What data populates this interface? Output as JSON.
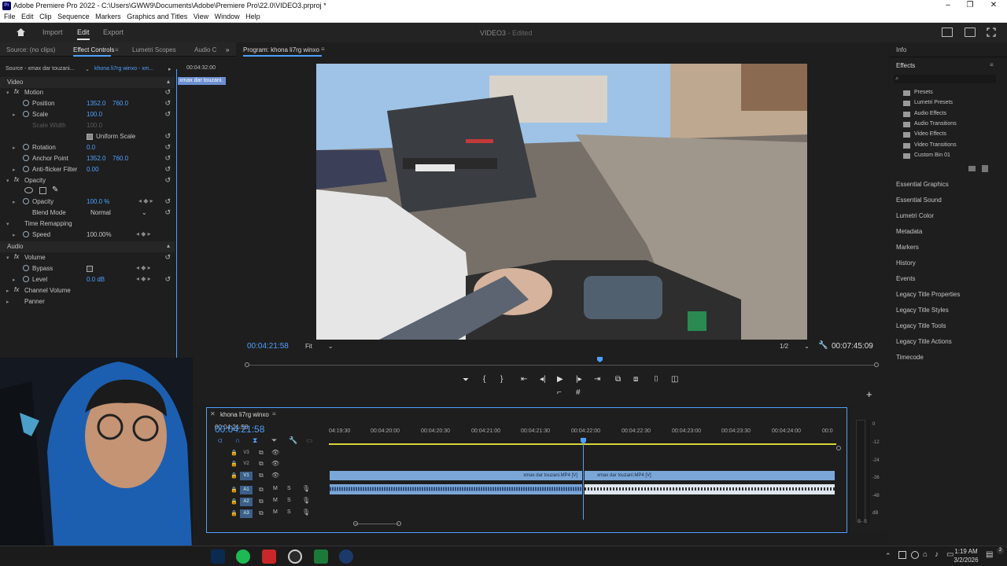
{
  "titlebar": {
    "logo": "Pr",
    "title": "Adobe Premiere Pro 2022 - C:\\Users\\GWW9\\Documents\\Adobe\\Premiere Pro\\22.0\\VIDEO3.prproj *",
    "min": "–",
    "max": "❐",
    "close": "✕"
  },
  "menu": [
    "File",
    "Edit",
    "Clip",
    "Sequence",
    "Markers",
    "Graphics and Titles",
    "View",
    "Window",
    "Help"
  ],
  "header": {
    "home_icon": "home-icon",
    "import": "Import",
    "edit": "Edit",
    "export": "Export",
    "project": "VIDEO3",
    "status": "- Edited"
  },
  "left_panel": {
    "tabs": [
      "Source: (no clips)",
      "Effect Controls",
      "Lumetri Scopes",
      "Audio C"
    ],
    "source": "Source - xmax dar touzani...",
    "sequence": "khona li7rg winxo - xm...",
    "timecode": "00:04:32:00",
    "clip_label": "xmax dar touzani.",
    "video_header": "Video",
    "motion": "Motion",
    "position_label": "Position",
    "position_x": "1352.0",
    "position_y": "760.0",
    "scale_label": "Scale",
    "scale": "100.0",
    "scale_width_label": "Scale Width",
    "scale_width": "100.0",
    "uniform_scale": "Uniform Scale",
    "rotation_label": "Rotation",
    "rotation": "0.0",
    "anchor_label": "Anchor Point",
    "anchor_x": "1352.0",
    "anchor_y": "760.0",
    "antiflicker_label": "Anti-flicker Filter",
    "antiflicker": "0.00",
    "opacity_header": "Opacity",
    "opacity_label": "Opacity",
    "opacity": "100.0 %",
    "blend_label": "Blend Mode",
    "blend": "Normal",
    "time_remap": "Time Remapping",
    "speed_label": "Speed",
    "speed": "100.00%",
    "audio_header": "Audio",
    "volume": "Volume",
    "bypass_label": "Bypass",
    "level_label": "Level",
    "level": "0.0 dB",
    "channel_volume": "Channel Volume",
    "panner": "Panner",
    "bottom_timecode": "00:04:..."
  },
  "program": {
    "tab": "Program: khona li7rg winxo",
    "current_tc": "00:04:21:58",
    "fit": "Fit",
    "quality": "1/2",
    "duration": "00:07:45:09",
    "plus": "+"
  },
  "timeline": {
    "tab": "khona li7rg winxo",
    "timecode": "00:04:21:58",
    "ruler": [
      "04:19:30",
      "00:04:20:00",
      "00:04:20:30",
      "00:04:21:00",
      "00:04:21:30",
      "00:04:22:00",
      "00:04:22:30",
      "00:04:23:00",
      "00:04:23:30",
      "00:04:24:00",
      "00:0"
    ],
    "tracks": [
      "V3",
      "V2",
      "V1",
      "A1",
      "A2",
      "A3"
    ],
    "clip1": "xmax dar touzani.MP4 [V]",
    "clip2": "xmax dar touzani.MP4 [V]",
    "m": "M",
    "s": "S"
  },
  "meter": {
    "ticks": [
      "0",
      "-12",
      "-24",
      "-36",
      "-48",
      "dB"
    ],
    "s1": "S",
    "s2": "S"
  },
  "right_panel": {
    "info": "Info",
    "effects": "Effects",
    "search_icon": "search-icon",
    "effect_folders": [
      "Presets",
      "Lumetri Presets",
      "Audio Effects",
      "Audio Transitions",
      "Video Effects",
      "Video Transitions",
      "Custom Bin 01"
    ],
    "panels": [
      "Essential Graphics",
      "Essential Sound",
      "Lumetri Color",
      "Metadata",
      "Markers",
      "History",
      "Events",
      "Legacy Title Properties",
      "Legacy Title Styles",
      "Legacy Title Tools",
      "Legacy Title Actions",
      "Timecode"
    ]
  },
  "taskbar": {
    "time": "1:19 AM",
    "date": "3/2/2026",
    "notif": "2"
  },
  "colors": {
    "accent": "#4ea0ff",
    "clip": "#7aa6d8",
    "playhead": "#4ea0ff"
  }
}
